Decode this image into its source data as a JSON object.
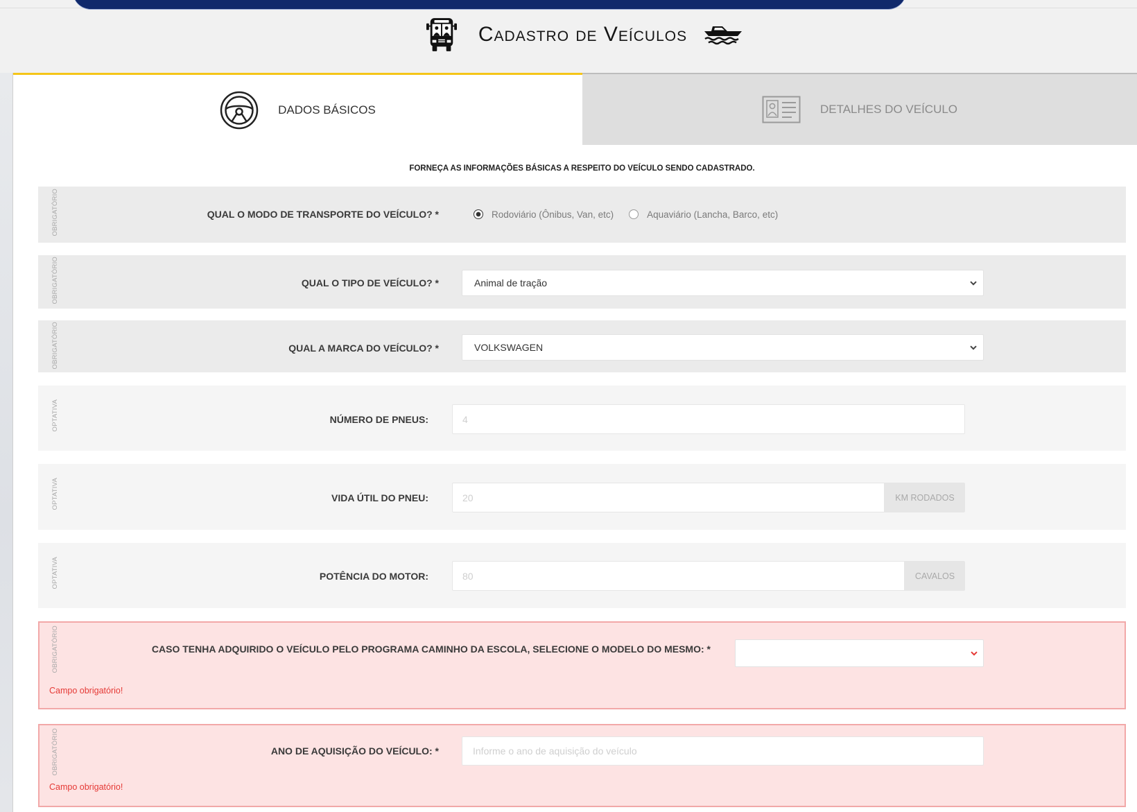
{
  "colors": {
    "banner": "#10296b",
    "accent": "#f5c518",
    "error": "#e53935",
    "error_bg": "#fde3e3"
  },
  "header": {
    "title": "Cadastro de Veículos",
    "left_icon": "bus-icon",
    "right_icon": "boat-icon"
  },
  "tabs": [
    {
      "label": "DADOS BÁSICOS",
      "icon": "steering-wheel-icon",
      "active": true
    },
    {
      "label": "DETALHES DO VEÍCULO",
      "icon": "id-card-icon",
      "active": false
    }
  ],
  "form": {
    "instructions": "FORNEÇA AS INFORMAÇÕES BÁSICAS A RESPEITO DO VEÍCULO SENDO CADASTRADO.",
    "transport_mode": {
      "tag": "OBRIGATÓRIO",
      "label": "QUAL O MODO DE TRANSPORTE DO VEÍCULO? *",
      "options": [
        {
          "label": "Rodoviário (Ônibus, Van, etc)",
          "checked": true
        },
        {
          "label": "Aquaviário (Lancha, Barco, etc)",
          "checked": false
        }
      ]
    },
    "vehicle_type": {
      "tag": "OBRIGATÓRIO",
      "label": "QUAL O TIPO DE VEÍCULO? *",
      "value": "Animal de tração"
    },
    "vehicle_brand": {
      "tag": "OBRIGATÓRIO",
      "label": "QUAL A MARCA DO VEÍCULO? *",
      "value": "VOLKSWAGEN"
    },
    "tire_count": {
      "tag": "OPTATIVA",
      "label": "NÚMERO DE PNEUS:",
      "placeholder": "4"
    },
    "tire_life": {
      "tag": "OPTATIVA",
      "label": "VIDA ÚTIL DO PNEU:",
      "placeholder": "20",
      "unit": "KM RODADOS"
    },
    "engine_power": {
      "tag": "OPTATIVA",
      "label": "POTÊNCIA DO MOTOR:",
      "placeholder": "80",
      "unit": "CAVALOS"
    },
    "school_program_model": {
      "tag": "OBRIGATÓRIO",
      "label": "CASO TENHA ADQUIRIDO O VEÍCULO PELO PROGRAMA CAMINHO DA ESCOLA, SELECIONE O MODELO DO MESMO: *",
      "value": "",
      "error": "Campo obrigatório!"
    },
    "acquisition_year": {
      "tag": "OBRIGATÓRIO",
      "label": "ANO DE AQUISIÇÃO DO VEÍCULO: *",
      "placeholder": "Informe o ano de aquisição do veículo",
      "error": "Campo obrigatório!"
    }
  }
}
